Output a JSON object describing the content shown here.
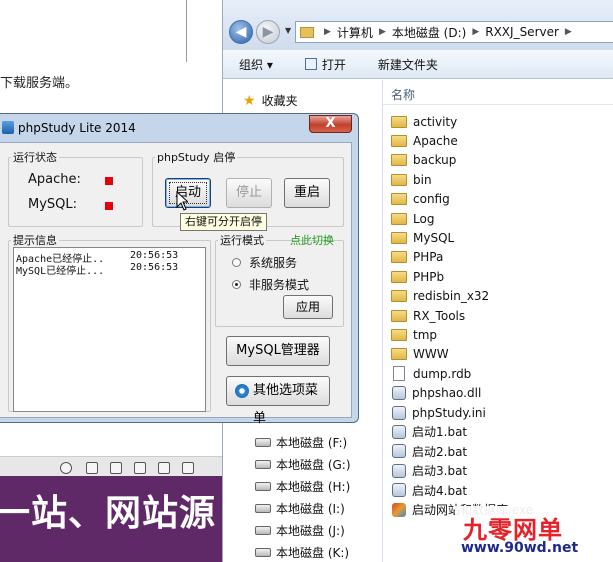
{
  "document": {
    "text": "下载服务端。",
    "banner_text": "一站、网站源"
  },
  "explorer": {
    "breadcrumb": [
      "计算机",
      "本地磁盘 (D:)",
      "RXXJ_Server"
    ],
    "commands": {
      "organize": "组织 ▾",
      "open": "打开",
      "new_folder": "新建文件夹"
    },
    "favorites": "收藏夹",
    "column_name": "名称",
    "drives": [
      "本地磁盘 (F:)",
      "本地磁盘 (G:)",
      "本地磁盘 (H:)",
      "本地磁盘 (I:)",
      "本地磁盘 (J:)",
      "本地磁盘 (K:)"
    ],
    "files": [
      {
        "name": "activity",
        "type": "folder"
      },
      {
        "name": "Apache",
        "type": "folder"
      },
      {
        "name": "backup",
        "type": "folder"
      },
      {
        "name": "bin",
        "type": "folder"
      },
      {
        "name": "config",
        "type": "folder"
      },
      {
        "name": "Log",
        "type": "folder"
      },
      {
        "name": "MySQL",
        "type": "folder"
      },
      {
        "name": "PHPa",
        "type": "folder"
      },
      {
        "name": "PHPb",
        "type": "folder"
      },
      {
        "name": "redisbin_x32",
        "type": "folder"
      },
      {
        "name": "RX_Tools",
        "type": "folder"
      },
      {
        "name": "tmp",
        "type": "folder"
      },
      {
        "name": "WWW",
        "type": "folder"
      },
      {
        "name": "dump.rdb",
        "type": "file"
      },
      {
        "name": "phpshao.dll",
        "type": "gear"
      },
      {
        "name": "phpStudy.ini",
        "type": "gear"
      },
      {
        "name": "启动1.bat",
        "type": "gear"
      },
      {
        "name": "启动2.bat",
        "type": "gear"
      },
      {
        "name": "启动3.bat",
        "type": "gear"
      },
      {
        "name": "启动4.bat",
        "type": "gear"
      },
      {
        "name": "启动网站和数据库.exe",
        "type": "exe"
      }
    ]
  },
  "dialog": {
    "title": "phpStudy Lite 2014",
    "close": "X",
    "status_group": "运行状态",
    "services": [
      {
        "name": "Apache:",
        "color": "#e6000c"
      },
      {
        "name": "MySQL:",
        "color": "#e6000c"
      }
    ],
    "control_group": "phpStudy 启停",
    "buttons": {
      "start": "启动",
      "stop": "停止",
      "restart": "重启",
      "apply": "应用",
      "mysql_manager": "MySQL管理器",
      "more_menu": "其他选项菜单"
    },
    "tooltip": "右键可分开启停",
    "log_group": "提示信息",
    "log": [
      {
        "msg": "Apache已经停止..",
        "time": "20:56:53"
      },
      {
        "msg": "MySQL已经停止...",
        "time": "20:56:53"
      }
    ],
    "mode_group": "运行模式",
    "mode_switch": "点此切换",
    "modes": [
      {
        "label": "系统服务",
        "selected": false
      },
      {
        "label": "非服务模式",
        "selected": true
      }
    ]
  },
  "watermark": {
    "title": "九零网单",
    "url": "www.90wd.net"
  }
}
